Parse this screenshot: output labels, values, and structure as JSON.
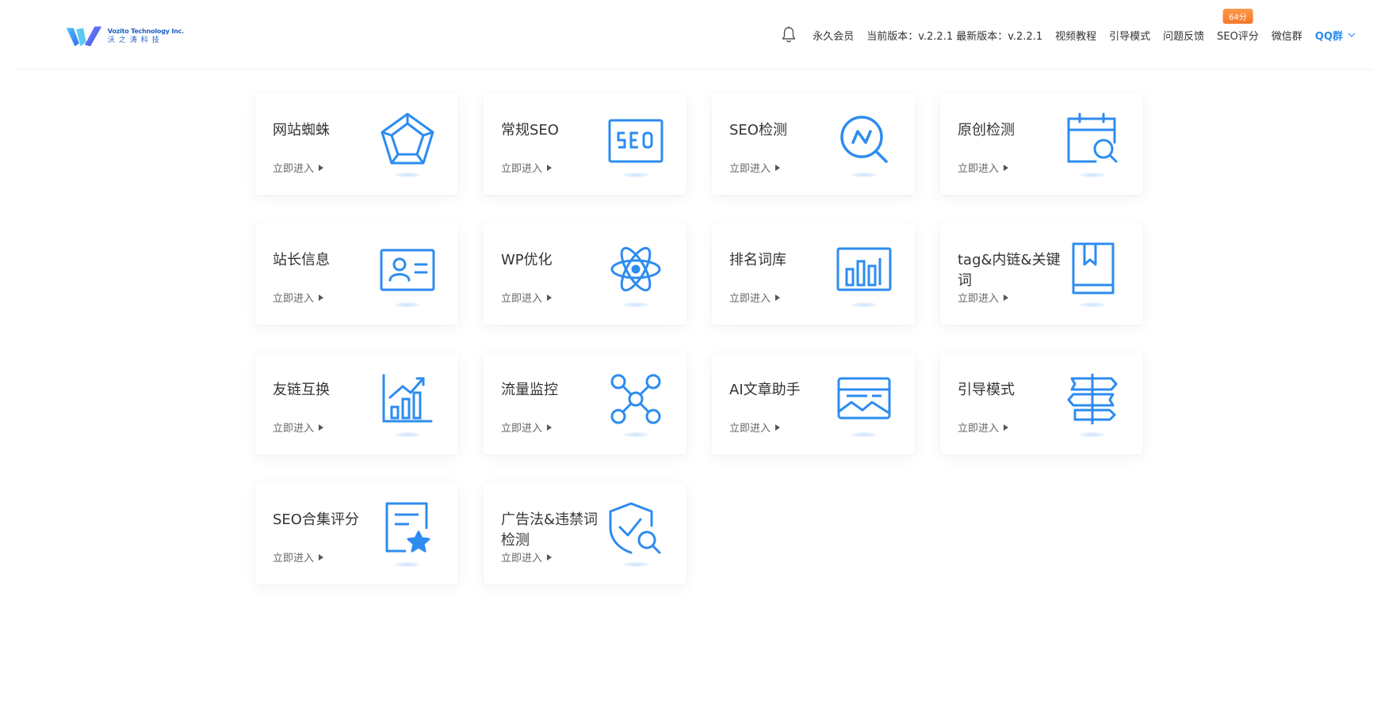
{
  "brand": {
    "name_en": "Vozito Technology Inc.",
    "name_cn": "沃之涛科技",
    "color": "#2d8cf0"
  },
  "nav": {
    "membership": "永久会员",
    "version": "当前版本：v.2.2.1 最新版本：v.2.2.1",
    "tutorial": "视频教程",
    "guide_mode": "引导模式",
    "feedback": "问题反馈",
    "seo_score": "SEO评分",
    "seo_score_badge": "64分",
    "wechat": "微信群",
    "qq": "QQ群"
  },
  "cards": [
    {
      "title": "网站蜘蛛",
      "link": "立即进入",
      "icon": "pentagon-radar-icon"
    },
    {
      "title": "常规SEO",
      "link": "立即进入",
      "icon": "seo-box-icon"
    },
    {
      "title": "SEO检测",
      "link": "立即进入",
      "icon": "search-pulse-icon"
    },
    {
      "title": "原创检测",
      "link": "立即进入",
      "icon": "calendar-search-icon"
    },
    {
      "title": "站长信息",
      "link": "立即进入",
      "icon": "id-card-icon"
    },
    {
      "title": "WP优化",
      "link": "立即进入",
      "icon": "atom-icon"
    },
    {
      "title": "排名词库",
      "link": "立即进入",
      "icon": "bar-chart-icon"
    },
    {
      "title": "tag&内链&关键词",
      "link": "立即进入",
      "icon": "bookmark-book-icon"
    },
    {
      "title": "友链互换",
      "link": "立即进入",
      "icon": "growth-chart-icon"
    },
    {
      "title": "流量监控",
      "link": "立即进入",
      "icon": "network-nodes-icon"
    },
    {
      "title": "AI文章助手",
      "link": "立即进入",
      "icon": "image-article-icon"
    },
    {
      "title": "引导模式",
      "link": "立即进入",
      "icon": "signpost-icon"
    },
    {
      "title": "SEO合集评分",
      "link": "立即进入",
      "icon": "document-star-icon"
    },
    {
      "title": "广告法&违禁词检测",
      "link": "立即进入",
      "icon": "shield-search-icon"
    }
  ]
}
